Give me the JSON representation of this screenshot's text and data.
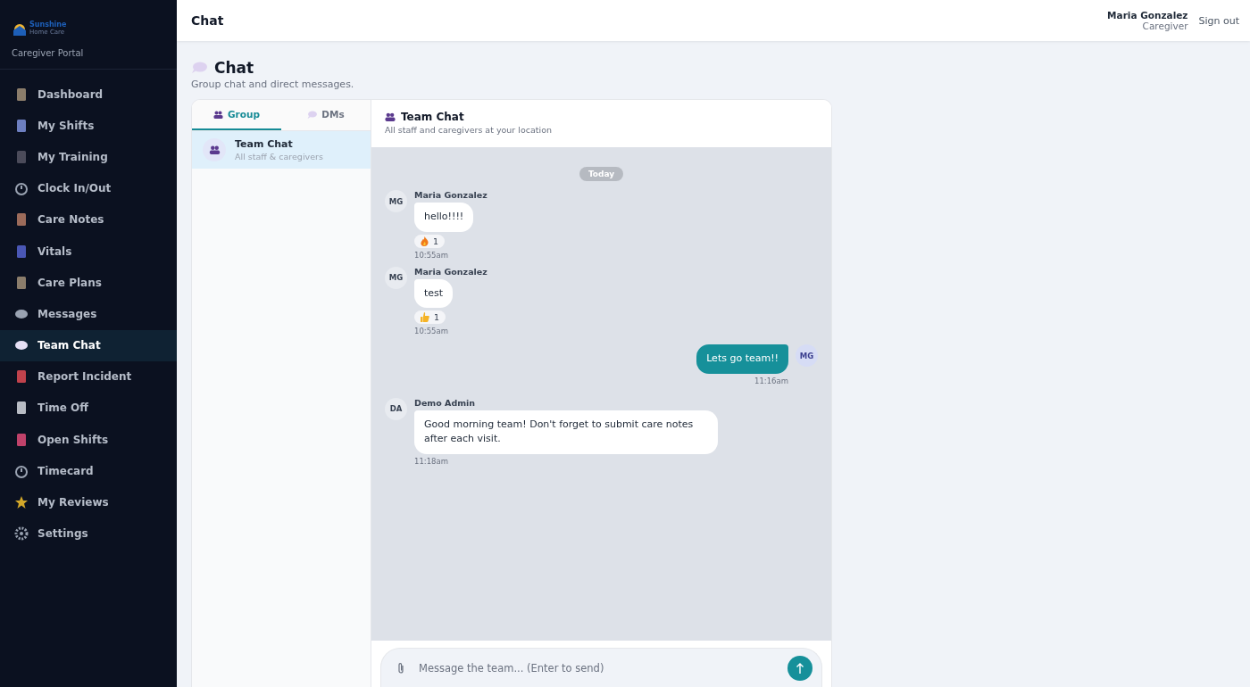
{
  "brand": {
    "name": "Sunshine",
    "tagline": "Home Care",
    "portal": "Caregiver Portal"
  },
  "nav": [
    {
      "label": "Dashboard",
      "selected": false
    },
    {
      "label": "My Shifts",
      "selected": false
    },
    {
      "label": "My Training",
      "selected": false
    },
    {
      "label": "Clock In/Out",
      "selected": false
    },
    {
      "label": "Care Notes",
      "selected": false
    },
    {
      "label": "Vitals",
      "selected": false
    },
    {
      "label": "Care Plans",
      "selected": false
    },
    {
      "label": "Messages",
      "selected": false
    },
    {
      "label": "Team Chat",
      "selected": true
    },
    {
      "label": "Report Incident",
      "selected": false
    },
    {
      "label": "Time Off",
      "selected": false
    },
    {
      "label": "Open Shifts",
      "selected": false
    },
    {
      "label": "Timecard",
      "selected": false
    },
    {
      "label": "My Reviews",
      "selected": false
    },
    {
      "label": "Settings",
      "selected": false
    }
  ],
  "topbar": {
    "title": "Chat",
    "user_name": "Maria Gonzalez",
    "user_role": "Caregiver",
    "sign_out": "Sign out"
  },
  "page": {
    "title": "Chat",
    "subtitle": "Group chat and direct messages."
  },
  "tabs": [
    {
      "label": "Group",
      "selected": true
    },
    {
      "label": "DMs",
      "selected": false
    }
  ],
  "conversations": [
    {
      "name": "Team Chat",
      "subtitle": "All staff & caregivers",
      "selected": true
    }
  ],
  "chat": {
    "title": "Team Chat",
    "subtitle": "All staff and caregivers at your location",
    "date_divider": "Today",
    "input_placeholder": "Message the team... (Enter to send)"
  },
  "messages": [
    {
      "kind": "incoming",
      "initials": "MG",
      "sender": "Maria Gonzalez",
      "text": "hello!!!!",
      "reactions": [
        {
          "kind": "fire",
          "count": "1"
        }
      ],
      "time": "10:55am"
    },
    {
      "kind": "incoming",
      "initials": "MG",
      "sender": "Maria Gonzalez",
      "text": "test",
      "reactions": [
        {
          "kind": "thumbs-up",
          "count": "1"
        }
      ],
      "time": "10:55am"
    },
    {
      "kind": "outgoing",
      "initials": "MG",
      "text": "Lets go team!!",
      "time": "11:16am"
    },
    {
      "kind": "incoming",
      "initials": "DA",
      "sender": "Demo Admin",
      "text": "Good morning team! Don't forget to submit care notes after each visit.",
      "time": "11:18am"
    }
  ]
}
